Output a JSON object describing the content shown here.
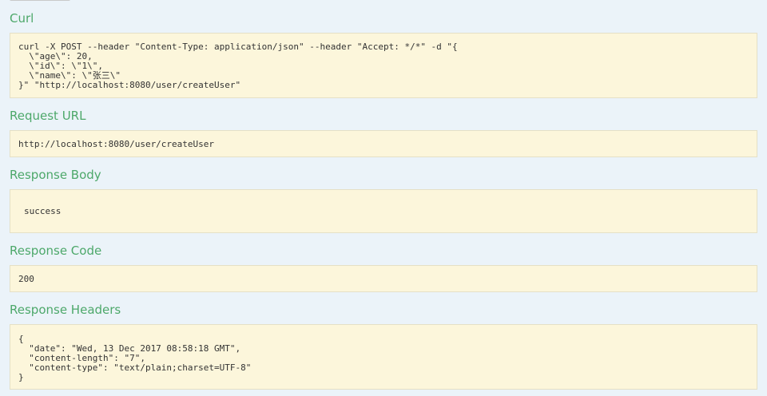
{
  "curl": {
    "label": "Curl",
    "command": "curl -X POST --header \"Content-Type: application/json\" --header \"Accept: */*\" -d \"{\n  \\\"age\\\": 20,\n  \\\"id\\\": \\\"1\\\",\n  \\\"name\\\": \\\"张三\\\"\n}\" \"http://localhost:8080/user/createUser\""
  },
  "request_url": {
    "label": "Request URL",
    "value": "http://localhost:8080/user/createUser"
  },
  "response_body": {
    "label": "Response Body",
    "value": "success"
  },
  "response_code": {
    "label": "Response Code",
    "value": "200"
  },
  "response_headers": {
    "label": "Response Headers",
    "value": "{\n  \"date\": \"Wed, 13 Dec 2017 08:58:18 GMT\",\n  \"content-length\": \"7\",\n  \"content-type\": \"text/plain;charset=UTF-8\"\n}"
  }
}
